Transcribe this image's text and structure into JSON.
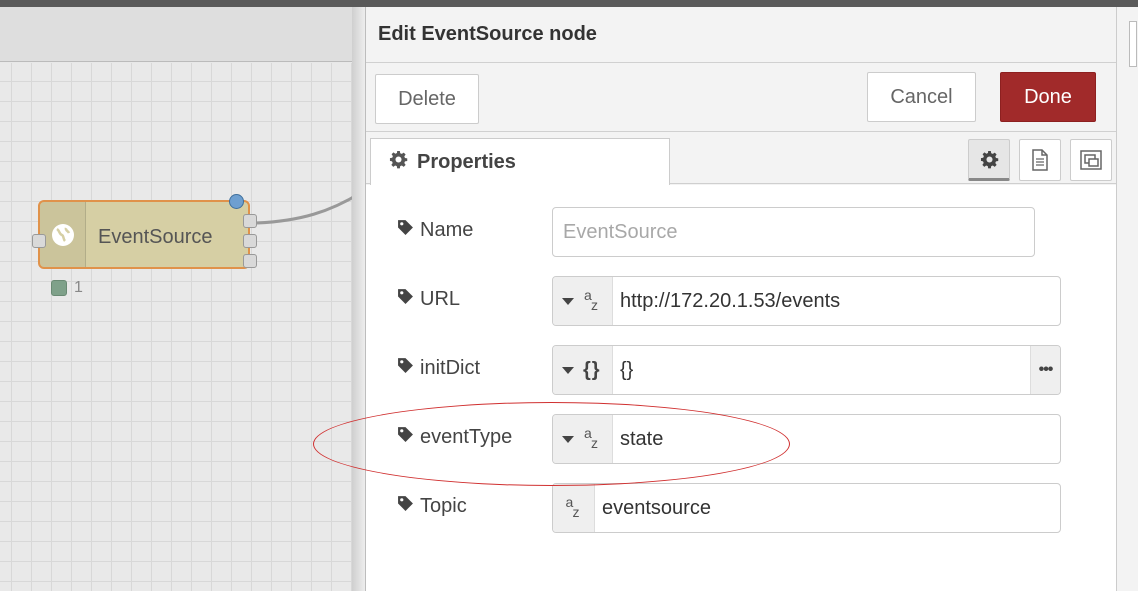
{
  "workspace": {
    "node": {
      "label": "EventSource",
      "status_text": "1",
      "icon": "globe-icon"
    }
  },
  "tray": {
    "title": "Edit EventSource node",
    "buttons": {
      "delete": "Delete",
      "cancel": "Cancel",
      "done": "Done"
    },
    "tabs": {
      "properties": "Properties",
      "icons": [
        "gear-icon",
        "document-icon",
        "appearance-icon"
      ]
    },
    "fields": {
      "name": {
        "label": "Name",
        "placeholder": "EventSource",
        "value": ""
      },
      "url": {
        "label": "URL",
        "type": "az",
        "value": "http://172.20.1.53/events"
      },
      "initdict": {
        "label": "initDict",
        "type": "{}",
        "value": "{}"
      },
      "eventtype": {
        "label": "eventType",
        "type": "az",
        "value": "state"
      },
      "topic": {
        "label": "Topic",
        "type": "az",
        "value": "eventsource"
      }
    }
  },
  "colors": {
    "done_button": "#a12a2a",
    "node_fill": "#d6cfa4",
    "node_border": "#e0924a",
    "annotation": "#d03030"
  }
}
